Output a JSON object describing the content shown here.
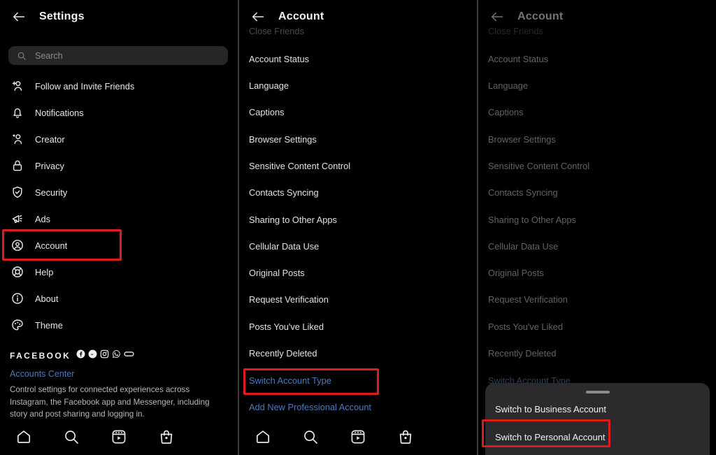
{
  "panel1": {
    "header": {
      "title": "Settings",
      "back_icon": "back-arrow-icon"
    },
    "search": {
      "placeholder": "Search",
      "icon": "search-icon"
    },
    "items": [
      {
        "label": "Follow and Invite Friends",
        "icon": "add-person-icon"
      },
      {
        "label": "Notifications",
        "icon": "bell-icon"
      },
      {
        "label": "Creator",
        "icon": "star-person-icon"
      },
      {
        "label": "Privacy",
        "icon": "lock-icon"
      },
      {
        "label": "Security",
        "icon": "shield-check-icon"
      },
      {
        "label": "Ads",
        "icon": "megaphone-icon"
      },
      {
        "label": "Account",
        "icon": "account-circle-icon"
      },
      {
        "label": "Help",
        "icon": "lifebuoy-icon"
      },
      {
        "label": "About",
        "icon": "info-circle-icon"
      },
      {
        "label": "Theme",
        "icon": "palette-icon"
      }
    ],
    "facebook": {
      "word": "FACEBOOK",
      "icons": [
        "facebook-icon",
        "messenger-icon",
        "instagram-icon",
        "whatsapp-icon",
        "portal-icon"
      ],
      "accounts_center": "Accounts Center",
      "description": "Control settings for connected experiences across Instagram, the Facebook app and Messenger, including story and post sharing and logging in."
    },
    "bottom_nav": [
      {
        "icon": "home-icon"
      },
      {
        "icon": "search-icon"
      },
      {
        "icon": "reels-icon"
      },
      {
        "icon": "shop-icon"
      }
    ],
    "highlight": "Account"
  },
  "panel2": {
    "header": {
      "title": "Account",
      "back_icon": "back-arrow-icon"
    },
    "items": [
      {
        "label": "Close Friends",
        "clipped": true
      },
      {
        "label": "Account Status"
      },
      {
        "label": "Language"
      },
      {
        "label": "Captions"
      },
      {
        "label": "Browser Settings"
      },
      {
        "label": "Sensitive Content Control"
      },
      {
        "label": "Contacts Syncing"
      },
      {
        "label": "Sharing to Other Apps"
      },
      {
        "label": "Cellular Data Use"
      },
      {
        "label": "Original Posts"
      },
      {
        "label": "Request Verification"
      },
      {
        "label": "Posts You've Liked"
      },
      {
        "label": "Recently Deleted"
      },
      {
        "label": "Switch Account Type",
        "blue": true
      },
      {
        "label": "Add New Professional Account",
        "blue": true
      }
    ],
    "bottom_nav": [
      {
        "icon": "home-icon"
      },
      {
        "icon": "search-icon"
      },
      {
        "icon": "reels-icon"
      },
      {
        "icon": "shop-icon"
      }
    ],
    "highlight": "Switch Account Type"
  },
  "panel3": {
    "header": {
      "title": "Account",
      "back_icon": "back-arrow-icon"
    },
    "items": [
      {
        "label": "Close Friends",
        "clipped": true
      },
      {
        "label": "Account Status"
      },
      {
        "label": "Language"
      },
      {
        "label": "Captions"
      },
      {
        "label": "Browser Settings"
      },
      {
        "label": "Sensitive Content Control"
      },
      {
        "label": "Contacts Syncing"
      },
      {
        "label": "Sharing to Other Apps"
      },
      {
        "label": "Cellular Data Use"
      },
      {
        "label": "Original Posts"
      },
      {
        "label": "Request Verification"
      },
      {
        "label": "Posts You've Liked"
      },
      {
        "label": "Recently Deleted"
      },
      {
        "label": "Switch Account Type",
        "blue": true
      }
    ],
    "sheet": {
      "handle": "drag-handle",
      "options": [
        {
          "label": "Switch to Business Account"
        },
        {
          "label": "Switch to Personal Account"
        }
      ]
    },
    "highlight": "Switch to Personal Account"
  },
  "colors": {
    "highlight_red": "#e01b1b",
    "link_blue": "#4a7ab8",
    "background": "#000000",
    "sheet_background": "#2b2b2e",
    "search_background": "#262626"
  }
}
